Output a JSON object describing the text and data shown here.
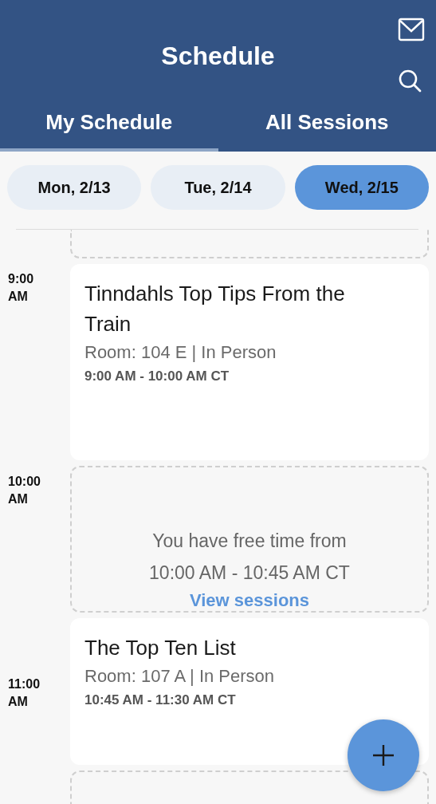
{
  "header": {
    "title": "Schedule"
  },
  "tabs": [
    {
      "label": "My Schedule",
      "selected": true
    },
    {
      "label": "All Sessions",
      "selected": false
    }
  ],
  "days": [
    {
      "label": "Mon, 2/13",
      "selected": false
    },
    {
      "label": "Tue, 2/14",
      "selected": false
    },
    {
      "label": "Wed, 2/15",
      "selected": true
    }
  ],
  "hours": [
    "9:00 AM",
    "10:00 AM",
    "11:00 AM"
  ],
  "slots": [
    {
      "kind": "free"
    },
    {
      "kind": "session",
      "title": "Tinndahls Top Tips From the Train",
      "room": "Room: 104 E | In Person",
      "time": "9:00 AM - 10:00 AM CT"
    },
    {
      "kind": "free",
      "text": "You have free time from",
      "range": "10:00 AM - 10:45 AM CT",
      "link": "View sessions"
    },
    {
      "kind": "session",
      "title": "The Top Ten List",
      "room": "Room: 107 A | In Person",
      "time": "10:45 AM - 11:30 AM CT"
    },
    {
      "kind": "free"
    }
  ]
}
